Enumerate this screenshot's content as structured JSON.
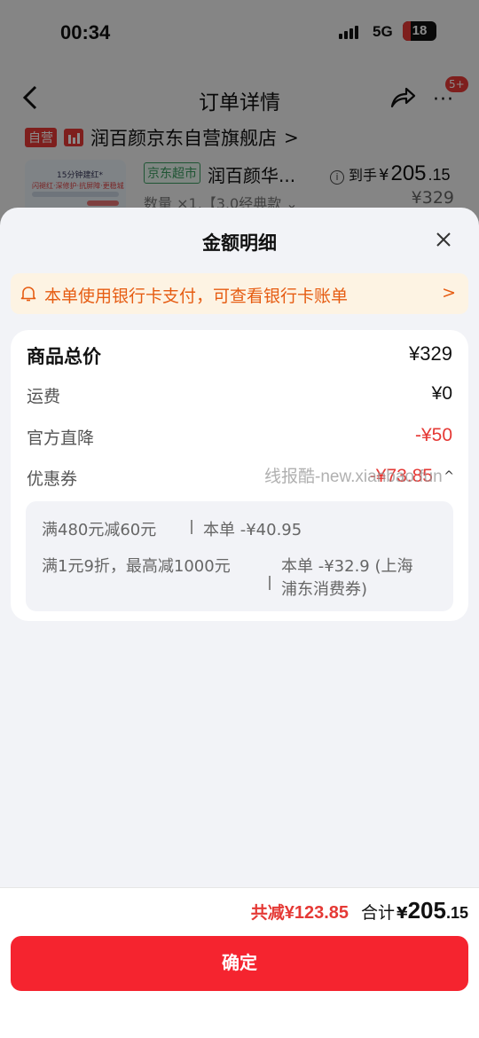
{
  "status_bar": {
    "time": "00:34",
    "network": "5G",
    "battery": "18"
  },
  "nav": {
    "title": "订单详情",
    "more": "···",
    "badge": "5+"
  },
  "store": {
    "tag": "自营",
    "name": "润百颜京东自营旗舰店",
    "chevron": ">"
  },
  "product": {
    "channel_tag": "京东超市",
    "name": "润百颜华...",
    "spec": "数量 ×1,【3.0经典款 ⌄",
    "arrive_label": "到手",
    "arrive_yen": "¥",
    "arrive_int": "205",
    "arrive_dec": ".15",
    "orig_price": "¥329",
    "image_text_1": "15分钟建红*",
    "image_text_2": "闪褪红·深修护·抗屏障·更稳城"
  },
  "sheet": {
    "title": "金额明细",
    "notice": "本单使用银行卡支付，可查看银行卡账单",
    "notice_chevron": ">",
    "rows": {
      "total": {
        "label": "商品总价",
        "value": "¥329"
      },
      "shipping": {
        "label": "运费",
        "value": "¥0"
      },
      "official": {
        "label": "官方直降",
        "value": "-¥50"
      },
      "coupon": {
        "label": "优惠券",
        "value": "-¥73.85",
        "caret": "^"
      }
    },
    "coupons": [
      {
        "rule": "满480元减60元",
        "amount": "本单 -¥40.95"
      },
      {
        "rule": "满1元9折，最高减1000元",
        "amount_line1": "本单 -¥32.9 (上海",
        "amount_line2": "浦东消费券)"
      }
    ]
  },
  "watermark": "线报酷-new.xianbao.fun",
  "footer": {
    "save_label": "共减",
    "save_value": "¥123.85",
    "total_label": "合计",
    "total_yen": "¥",
    "total_int": "205",
    "total_dec": ".15",
    "confirm": "确定"
  },
  "colors": {
    "accent_red": "#e53935",
    "button_red": "#f5242f",
    "notice_orange": "#e65c12",
    "notice_bg": "#fdf3e3"
  }
}
